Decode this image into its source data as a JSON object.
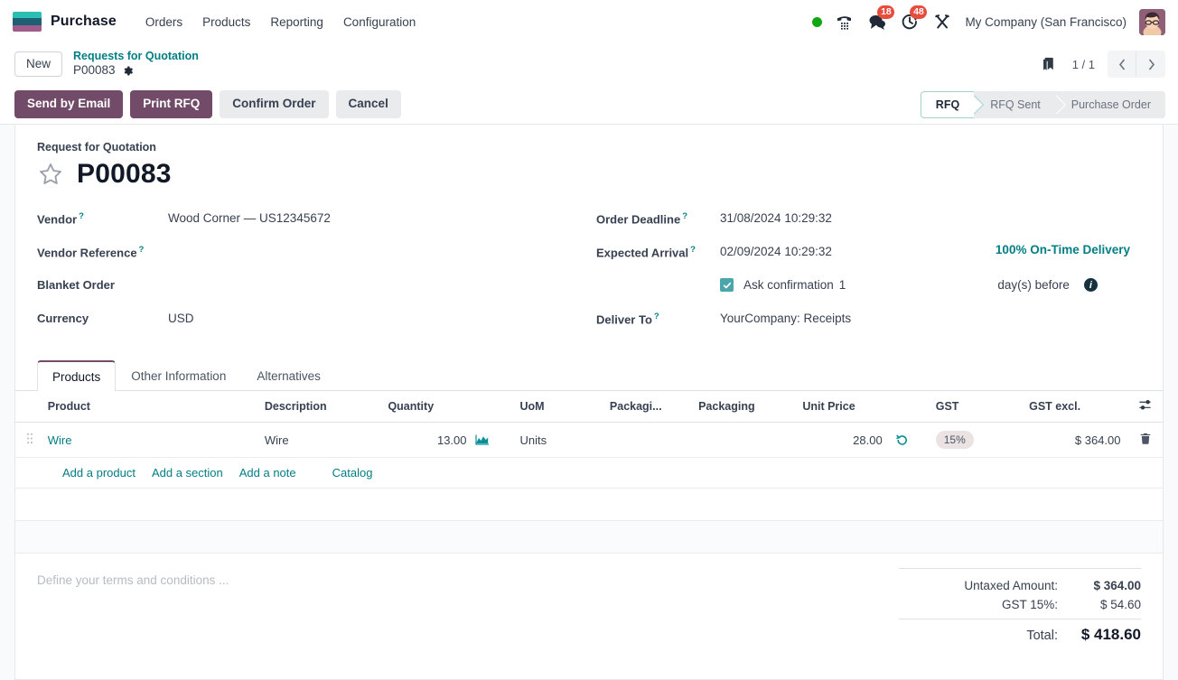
{
  "navbar": {
    "brand": "Purchase",
    "menu": [
      "Orders",
      "Products",
      "Reporting",
      "Configuration"
    ],
    "systray": {
      "presence_icon": "green-dot-icon",
      "dialpad_icon": "phone-dialpad-icon",
      "messages_icon": "chat-bubble-icon",
      "messages_count": "18",
      "activities_icon": "clock-icon",
      "activities_count": "48",
      "apps_icon": "tools-icon",
      "company": "My Company (San Francisco)",
      "avatar_icon": "user-avatar"
    }
  },
  "controlpanel": {
    "new_label": "New",
    "breadcrumb_parent": "Requests for Quotation",
    "breadcrumb_current": "P00083",
    "settings_icon": "gear-icon",
    "save_icon": "bookmark-icon",
    "pager": "1 / 1",
    "prev_icon": "chevron-left-icon",
    "next_icon": "chevron-right-icon",
    "buttons": [
      {
        "label": "Send by Email",
        "style": "primary"
      },
      {
        "label": "Print RFQ",
        "style": "primary"
      },
      {
        "label": "Confirm Order",
        "style": "secondary"
      },
      {
        "label": "Cancel",
        "style": "secondary"
      }
    ],
    "statusbar": [
      "RFQ",
      "RFQ Sent",
      "Purchase Order"
    ],
    "statusbar_active": "RFQ"
  },
  "form": {
    "subtitle": "Request for Quotation",
    "title": "P00083",
    "star_icon": "star-outline-icon",
    "left_fields": [
      {
        "label": "Vendor",
        "help": "?",
        "value": "Wood Corner — US12345672"
      },
      {
        "label": "Vendor Reference",
        "help": "?",
        "value": ""
      },
      {
        "label": "Blanket Order",
        "help": "",
        "value": ""
      },
      {
        "label": "Currency",
        "help": "",
        "value": "USD"
      }
    ],
    "right_fields": [
      {
        "label": "Order Deadline",
        "help": "?",
        "value": "31/08/2024 10:29:32"
      },
      {
        "label": "Expected Arrival",
        "help": "?",
        "value": "02/09/2024 10:29:32"
      },
      {
        "label": "Deliver To",
        "help": "?",
        "value": "YourCompany: Receipts"
      }
    ],
    "on_time_delivery": "100% On-Time Delivery",
    "ask_confirmation": {
      "checkbox_icon": "checkbox-checked-icon",
      "label": "Ask confirmation",
      "days": "1",
      "suffix": "day(s) before",
      "info_icon": "info-icon"
    }
  },
  "notebook": {
    "tabs": [
      "Products",
      "Other Information",
      "Alternatives"
    ],
    "active_tab": "Products"
  },
  "lines_table": {
    "headers": [
      "Product",
      "Description",
      "Quantity",
      "UoM",
      "Packagi...",
      "Packaging",
      "Unit Price",
      "GST",
      "GST excl."
    ],
    "optional_columns_icon": "sliders-icon",
    "rows": [
      {
        "handle_icon": "drag-handle-icon",
        "product": "Wire",
        "description": "Wire",
        "quantity": "13.00",
        "forecast_icon": "area-chart-icon",
        "uom": "Units",
        "packaging_qty": "",
        "packaging": "",
        "unit_price": "28.00",
        "history_icon": "history-icon",
        "tax": "15%",
        "subtotal": "$ 364.00",
        "delete_icon": "trash-icon"
      }
    ],
    "add_links": [
      "Add a product",
      "Add a section",
      "Add a note"
    ],
    "catalog_link": "Catalog"
  },
  "footer": {
    "terms_placeholder": "Define your terms and conditions ...",
    "totals": [
      {
        "label": "Untaxed Amount:",
        "value": "$ 364.00",
        "kind": "untaxed"
      },
      {
        "label": "GST 15%:",
        "value": "$ 54.60",
        "kind": "tax"
      },
      {
        "label": "Total:",
        "value": "$ 418.60",
        "kind": "total"
      }
    ]
  },
  "colors": {
    "brand_primary": "#714b67",
    "accent_teal": "#017e84",
    "badge_red": "#e74c3c",
    "presence_green": "#12a612"
  }
}
